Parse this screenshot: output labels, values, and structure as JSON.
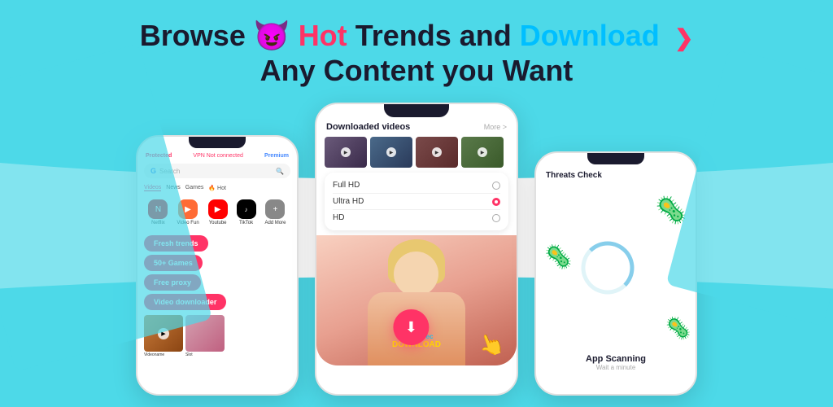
{
  "headline": {
    "line1_prefix": "Browse ",
    "hot_word": "Hot",
    "line1_suffix": " Trends and ",
    "download_word": "Download",
    "line2": "Any Content you Want"
  },
  "left_phone": {
    "status": {
      "protected": "Protected",
      "vpn": "VPN Not connected",
      "premium": "Premium"
    },
    "search_placeholder": "Search",
    "nav_tabs": [
      "Videos",
      "News",
      "Games",
      "Hot"
    ],
    "apps": [
      {
        "name": "Netflix",
        "color": "netflix"
      },
      {
        "name": "Video Fun",
        "color": "videofun"
      },
      {
        "name": "Youtube",
        "color": "youtube"
      },
      {
        "name": "TikTok",
        "color": "tiktok"
      },
      {
        "name": "Add More",
        "color": "addmore"
      }
    ],
    "pills": [
      "Fresh trends",
      "50+ Games",
      "Free proxy",
      "Video downloader"
    ],
    "thumb_labels": [
      "Videoname",
      "Slot"
    ]
  },
  "middle_phone": {
    "downloaded_label": "Downloaded videos",
    "more_label": "More >",
    "resolutions": [
      {
        "label": "Full HD",
        "selected": false
      },
      {
        "label": "Ultra HD",
        "selected": true
      },
      {
        "label": "HD",
        "selected": false
      }
    ],
    "download_speed": "248mb/sec",
    "download_label": "DOWNLOAD"
  },
  "right_phone": {
    "threats_label": "Threats Check",
    "scanning_label": "App Scanning",
    "wait_label": "Wait a minute"
  }
}
